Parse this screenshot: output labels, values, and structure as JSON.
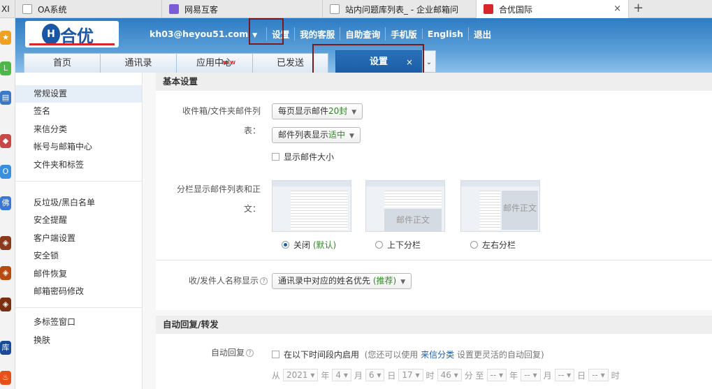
{
  "browser": {
    "tabs": [
      {
        "title": "OA系统"
      },
      {
        "title": "网易互客"
      },
      {
        "title": "站内问题库列表_ - 企业邮箱问"
      },
      {
        "title": "合优国际"
      }
    ],
    "active_close": "×",
    "new_tab": "+",
    "edge_left_text": "XI"
  },
  "leftbar": {
    "icons": [
      "star",
      "L",
      "doc",
      "pin",
      "O",
      "佛",
      "game1",
      "game2",
      "game3",
      "库",
      "fire"
    ],
    "labels": {
      "L": "L",
      "O": "O",
      "fo": "佛",
      "ku": "库"
    }
  },
  "header": {
    "logo": {
      "mark": "H",
      "brand": "合优"
    },
    "user_email": "kh03@heyou51.com",
    "nav": [
      "设置",
      "我的客服",
      "自助查询",
      "手机版",
      "English",
      "退出"
    ]
  },
  "tabs": {
    "items": [
      "首页",
      "通讯录",
      "应用中心",
      "已发送"
    ],
    "new_badge": "NEW",
    "active": "设置",
    "active_close": "×",
    "more": "⌄"
  },
  "sidebar": {
    "groups": [
      [
        "常规设置",
        "签名",
        "来信分类",
        "帐号与邮箱中心",
        "文件夹和标签"
      ],
      [
        "反垃圾/黑白名单",
        "安全提醒",
        "客户端设置",
        "安全锁",
        "邮件恢复",
        "邮箱密码修改"
      ],
      [
        "多标签窗口",
        "换肤"
      ]
    ]
  },
  "basic": {
    "title": "基本设置",
    "list_label_1": "收件箱/文件夹邮件列",
    "list_label_2": "表：",
    "per_page_prefix": "每页显示邮件",
    "per_page_value": "20封",
    "density_prefix": "邮件列表显示",
    "density_value": "适中",
    "show_size": "显示邮件大小",
    "split_label_1": "分栏显示邮件列表和正",
    "split_label_2": "文：",
    "preview_body_text": "邮件正文",
    "split_options": [
      {
        "label": "关闭",
        "note": "(默认)"
      },
      {
        "label": "上下分栏"
      },
      {
        "label": "左右分栏"
      }
    ],
    "sender_label": "收/发件人名称显示",
    "sender_value": "通讯录中对应的姓名优先",
    "sender_note": "(推荐)"
  },
  "auto": {
    "title": "自动回复/转发",
    "label": "自动回复",
    "enable": "在以下时间段内启用",
    "hint_prefix": "(您还可以使用",
    "hint_link": "来信分类",
    "hint_suffix": "设置更灵活的自动回复)",
    "from": "从",
    "year": "2021",
    "year_unit": "年",
    "month": "4",
    "month_unit": "月",
    "day": "6",
    "day_unit": "日",
    "hour": "17",
    "hour_unit": "时",
    "minute": "46",
    "minute_unit": "分",
    "to": "至",
    "blank": "--"
  },
  "colors": {
    "accent": "#1a5ea8",
    "highlight_box": "#7a1a1a",
    "green": "#2b8a1f"
  }
}
